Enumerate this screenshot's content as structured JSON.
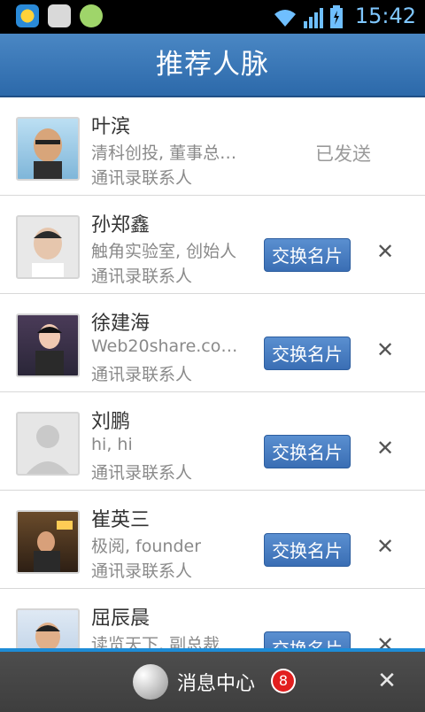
{
  "status_bar": {
    "time": "15:42",
    "icons": [
      "qq-icon",
      "message-icon",
      "wechat-icon",
      "wifi-icon",
      "signal-icon",
      "battery-icon"
    ]
  },
  "header": {
    "title": "推荐人脉"
  },
  "contacts": [
    {
      "name": "叶滨",
      "detail": "清科创投, 董事总经理",
      "source": "通讯录联系人",
      "status": "已发送"
    },
    {
      "name": "孙郑鑫",
      "detail": "触角实验室, 创始人",
      "source": "通讯录联系人",
      "action": "交换名片"
    },
    {
      "name": "徐建海",
      "detail": "Web20share.com...",
      "source": "通讯录联系人",
      "action": "交换名片"
    },
    {
      "name": "刘鹏",
      "detail": "hi, hi",
      "source": "通讯录联系人",
      "action": "交换名片"
    },
    {
      "name": "崔英三",
      "detail": "极阅, founder",
      "source": "通讯录联系人",
      "action": "交换名片"
    },
    {
      "name": "屈辰晨",
      "detail": "读览天下, 副总裁",
      "source": "",
      "action": "交换名片"
    }
  ],
  "bottom_bar": {
    "label": "消息中心",
    "badge_count": "8"
  },
  "colors": {
    "header": "#3a78b8",
    "button": "#4a7fc4",
    "badge": "#e21e1e",
    "accent": "#1e8cd6"
  }
}
